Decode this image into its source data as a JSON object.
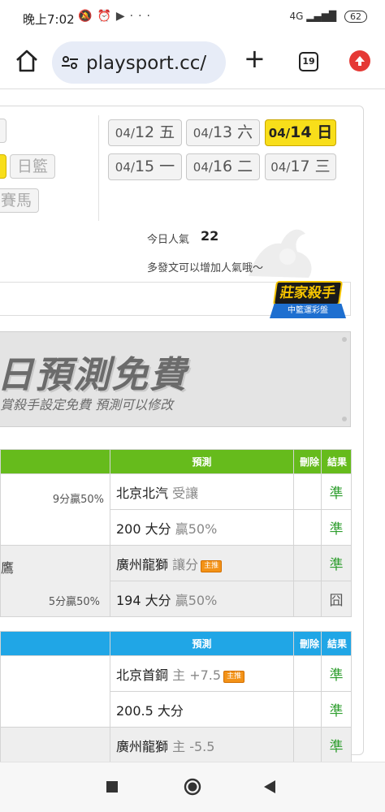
{
  "status_bar": {
    "time": "晚上7:02",
    "icons": [
      "mute-bell-icon",
      "alarm-icon",
      "youtube-icon",
      "more-dots-icon"
    ],
    "network": "4G",
    "battery": "62"
  },
  "browser": {
    "url": "playsport.cc/",
    "tab_count": "19"
  },
  "sports": [
    "日籃",
    "賽馬"
  ],
  "dates": [
    {
      "md": "04/",
      "d": "12",
      "w": "五",
      "active": false
    },
    {
      "md": "04/",
      "d": "13",
      "w": "六",
      "active": false
    },
    {
      "md": "04/",
      "d": "14",
      "w": "日",
      "active": true
    },
    {
      "md": "04/",
      "d": "15",
      "w": "一",
      "active": false
    },
    {
      "md": "04/",
      "d": "16",
      "w": "二",
      "active": false
    },
    {
      "md": "04/",
      "d": "17",
      "w": "三",
      "active": false
    }
  ],
  "popularity": {
    "label": "今日人氣",
    "value": "22",
    "tip": "多發文可以增加人氣哦～"
  },
  "badge": {
    "title": "莊家殺手",
    "subtitle": "中籃運彩盤"
  },
  "banner": {
    "headline": "日預測免費",
    "subline": "賞殺手設定免費 預測可以修改"
  },
  "table1": {
    "headers": {
      "predict": "預測",
      "delete": "刪除",
      "result": "結果"
    },
    "rows": [
      {
        "left": "9分贏50%",
        "team": "北京北汽",
        "note": "受讓",
        "tag": "",
        "result": "準"
      },
      {
        "left": "",
        "team": "200 大分",
        "note": "贏50%",
        "tag": "",
        "result": "準"
      },
      {
        "left": "鷹",
        "team": "廣州龍獅",
        "note": "讓分",
        "tag": "主推",
        "result": "準"
      },
      {
        "left": "5分贏50%",
        "team": "194 大分",
        "note": "贏50%",
        "tag": "",
        "result": "囧"
      }
    ]
  },
  "table2": {
    "headers": {
      "predict": "預測",
      "delete": "刪除",
      "result": "結果"
    },
    "rows": [
      {
        "team": "北京首鋼",
        "note": "主 +7.5",
        "tag": "主推",
        "result": "準"
      },
      {
        "team": "200.5 大分",
        "note": "",
        "tag": "",
        "result": "準"
      },
      {
        "team": "廣州龍獅",
        "note": "主 -5.5",
        "tag": "",
        "result": "準"
      }
    ]
  },
  "colors": {
    "active_date": "#f8de1a",
    "table1_header": "#66bb1c",
    "table2_header": "#20a6e6",
    "result_green": "#2e9e2e",
    "tag_orange": "#f39217"
  }
}
